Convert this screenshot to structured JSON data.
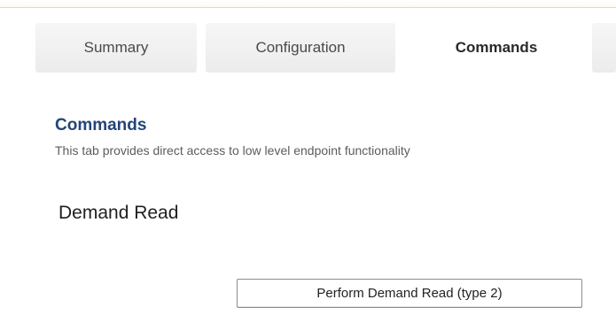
{
  "tabs": [
    {
      "label": "Summary",
      "active": false
    },
    {
      "label": "Configuration",
      "active": false
    },
    {
      "label": "Commands",
      "active": true
    }
  ],
  "section": {
    "title": "Commands",
    "description": "This tab provides direct access to low level endpoint functionality"
  },
  "demand_read": {
    "heading": "Demand Read",
    "button_label": "Perform Demand Read (type 2)"
  },
  "colors": {
    "title_blue": "#24447a",
    "top_rule": "#ecd9a6",
    "inactive_tab": "#efefef"
  }
}
